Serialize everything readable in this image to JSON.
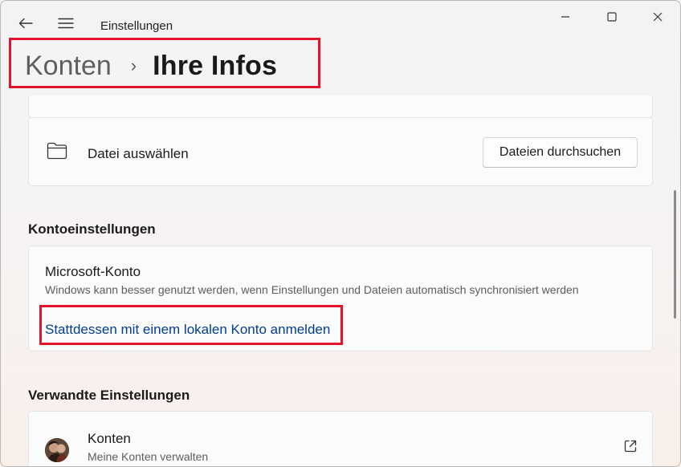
{
  "window": {
    "title": "Einstellungen"
  },
  "breadcrumb": {
    "parent": "Konten",
    "separator": "›",
    "current": "Ihre Infos"
  },
  "file_card": {
    "label": "Datei auswählen",
    "button": "Dateien durchsuchen"
  },
  "account_settings": {
    "heading": "Kontoeinstellungen",
    "title": "Microsoft-Konto",
    "description": "Windows kann besser genutzt werden, wenn Einstellungen und Dateien automatisch synchronisiert werden",
    "link": "Stattdessen mit einem lokalen Konto anmelden"
  },
  "related": {
    "heading": "Verwandte Einstellungen",
    "item_title": "Konten",
    "item_subtitle": "Meine Konten verwalten"
  },
  "colors": {
    "accent_link": "#003e92",
    "highlight": "#e3142b"
  }
}
